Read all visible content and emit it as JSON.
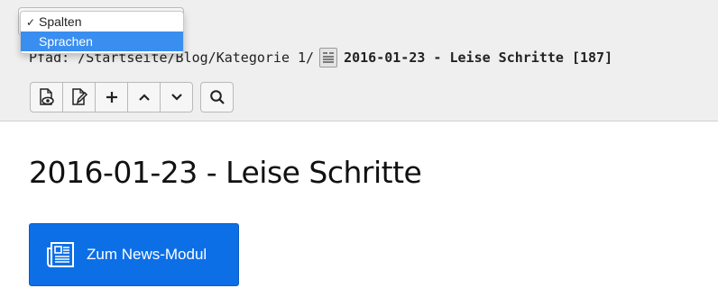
{
  "dropdown": {
    "options": [
      {
        "label": "Spalten",
        "checked": true
      },
      {
        "label": "Sprachen",
        "highlighted": true
      }
    ],
    "checkmark": "✓"
  },
  "breadcrumb": {
    "path": "Pfad: /Startseite/Blog/Kategorie 1/",
    "title": "2016-01-23 - Leise Schritte [187]"
  },
  "toolbar": {
    "buttons": [
      "preview-icon",
      "edit-icon",
      "plus-icon",
      "chevron-up-icon",
      "chevron-down-icon",
      "search-icon"
    ]
  },
  "main": {
    "heading": "2016-01-23 - Leise Schritte",
    "news_button_label": "Zum News-Modul"
  },
  "colors": {
    "accent": "#0d6fe6",
    "selection": "#3a8eef"
  }
}
